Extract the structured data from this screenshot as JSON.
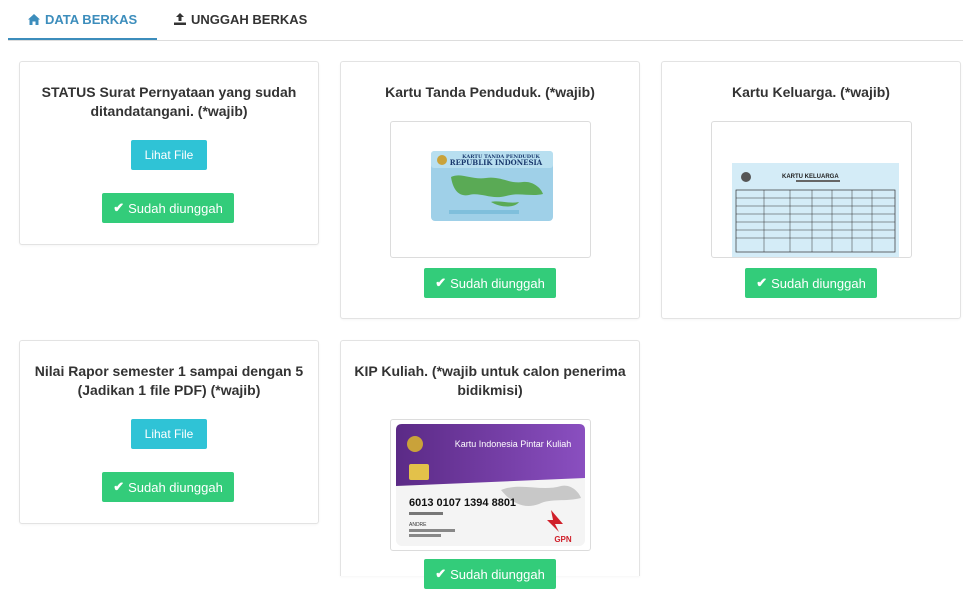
{
  "tabs": {
    "data_berkas": "DATA BERKAS",
    "unggah_berkas": "UNGGAH BERKAS"
  },
  "cards": {
    "surat": {
      "title": "STATUS Surat Pernyataan yang sudah ditandatangani. (*wajib)",
      "view_label": "Lihat File",
      "status_label": "Sudah diunggah"
    },
    "ktp": {
      "title": "Kartu Tanda Penduduk. (*wajib)",
      "image_text": [
        "KARTU TANDA PENDUDUK",
        "REPUBLIK INDONESIA"
      ],
      "status_label": "Sudah diunggah"
    },
    "kk": {
      "title": "Kartu Keluarga. (*wajib)",
      "image_text": [
        "KARTU KELUARGA"
      ],
      "status_label": "Sudah diunggah"
    },
    "rapor": {
      "title": "Nilai Rapor semester 1 sampai dengan 5 (Jadikan 1 file PDF) (*wajib)",
      "view_label": "Lihat File",
      "status_label": "Sudah diunggah"
    },
    "kip": {
      "title": "KIP Kuliah. (*wajib untuk calon penerima bidikmisi)",
      "image_text": [
        "Kartu Indonesia Pintar Kuliah",
        "6013 0107 1394 8801",
        "ANDRE",
        "GPN"
      ],
      "status_label": "Sudah diunggah"
    }
  },
  "colors": {
    "accent": "#3c8dbc",
    "info": "#2fc3d6",
    "success": "#33cc7a"
  }
}
